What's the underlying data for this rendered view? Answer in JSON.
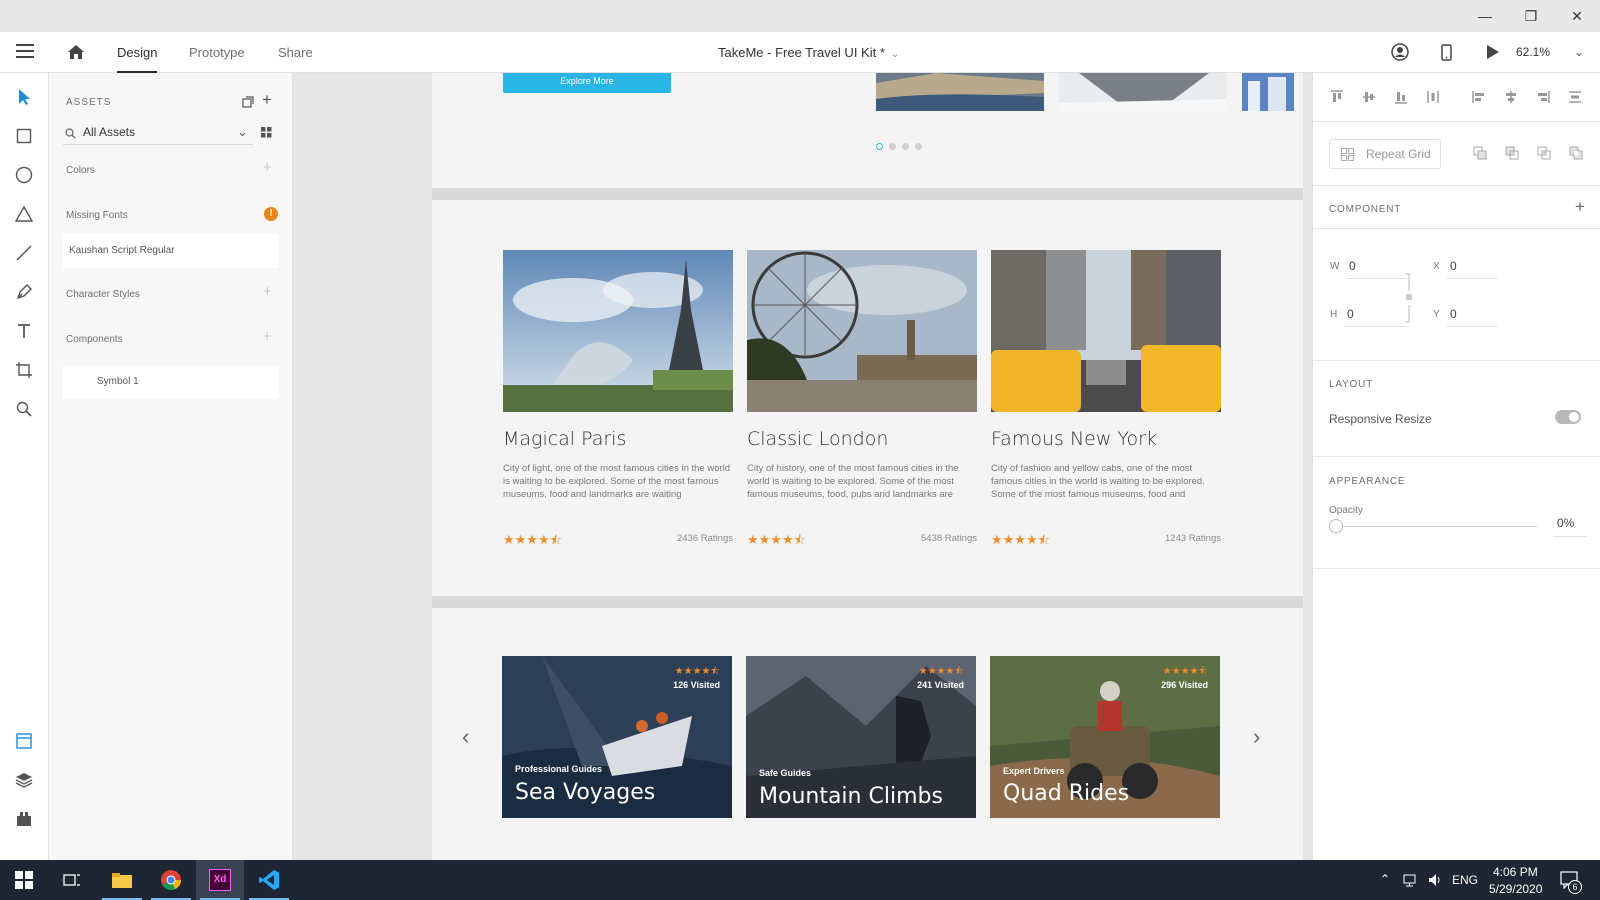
{
  "window": {
    "minimize_glyph": "—",
    "restore_glyph": "❐",
    "close_glyph": "✕"
  },
  "appbar": {
    "tabs": [
      {
        "label": "Design",
        "active": true
      },
      {
        "label": "Prototype",
        "active": false
      },
      {
        "label": "Share",
        "active": false
      }
    ],
    "doc_title": "TakeMe - Free Travel UI Kit *",
    "zoom": "62.1%"
  },
  "assets": {
    "header": "ASSETS",
    "search_value": "All Assets",
    "sections": {
      "colors": "Colors",
      "missing_fonts": "Missing Fonts",
      "missing_font_item": "Kaushan Script Regular",
      "character_styles": "Character Styles",
      "components": "Components",
      "component_item": "Symbol 1"
    },
    "warning_glyph": "!"
  },
  "canvas": {
    "explore_button": "Explore More",
    "slides_active_index": 0,
    "cards": [
      {
        "title": "Magical Paris",
        "desc": "City of light, one of the most famous cities in the world is waiting to be explored. Some of the most famous museums, food and landmarks are waiting",
        "stars": "★★★★⯪",
        "ratings": "2436 Ratings"
      },
      {
        "title": "Classic London",
        "desc": "City of history, one of the most famous cities in the world is waiting to be explored. Some of the most famous museums, food, pubs and landmarks are",
        "stars": "★★★★⯪",
        "ratings": "5438 Ratings"
      },
      {
        "title": "Famous New York",
        "desc": "City of fashion and yellow cabs, one of the most famous cities in the world is waiting to be explored. Some of the most famous museums, food and",
        "stars": "★★★★⯪",
        "ratings": "1243 Ratings"
      }
    ],
    "tours": [
      {
        "subtitle": "Professional Guides",
        "title": "Sea Voyages",
        "stars": "★★★★⯪",
        "visited": "126 Visited"
      },
      {
        "subtitle": "Safe Guides",
        "title": "Mountain Climbs",
        "stars": "★★★★⯪",
        "visited": "241 Visited"
      },
      {
        "subtitle": "Expert Drivers",
        "title": "Quad Rides",
        "stars": "★★★★⯪",
        "visited": "296 Visited"
      }
    ],
    "arrow_left": "‹",
    "arrow_right": "›"
  },
  "props": {
    "repeat_grid": "Repeat Grid",
    "component_label": "COMPONENT",
    "w_label": "W",
    "w_value": "0",
    "h_label": "H",
    "h_value": "0",
    "x_label": "X",
    "x_value": "0",
    "y_label": "Y",
    "y_value": "0",
    "layout_label": "LAYOUT",
    "responsive_resize": "Responsive Resize",
    "responsive_resize_on": true,
    "appearance_label": "APPEARANCE",
    "opacity_label": "Opacity",
    "opacity_value": "0%"
  },
  "taskbar": {
    "language": "ENG",
    "time": "4:06 PM",
    "date": "5/29/2020",
    "notifications": "6",
    "xd_label": "Xd"
  },
  "colors": {
    "accent_blue": "#29b6e6",
    "star_orange": "#f08c2b",
    "taskbar": "#1f2633",
    "warning": "#e68619"
  }
}
